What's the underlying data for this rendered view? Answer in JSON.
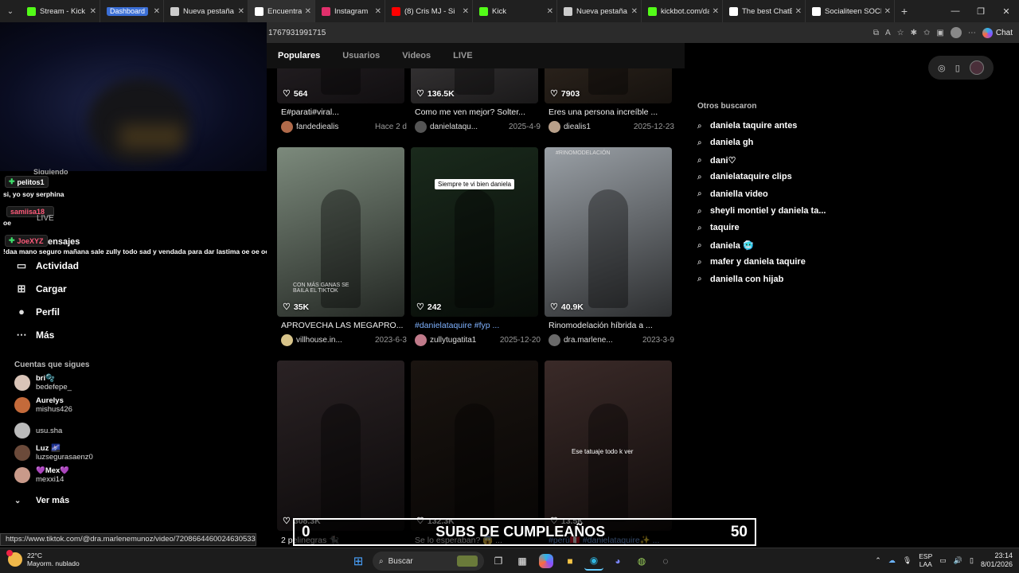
{
  "tabs": [
    {
      "label": "Stream - Kick Dash",
      "icon": "kick-icon",
      "color": "#53fc18"
    },
    {
      "label": "Dashboard",
      "icon": "badge-icon",
      "color": "#3b6fd6"
    },
    {
      "label": "Nueva pestaña",
      "icon": "page-icon",
      "color": "#cccccc"
    },
    {
      "label": "Encuentra 'Daniela",
      "icon": "tiktok-icon",
      "color": "#ffffff",
      "active": true
    },
    {
      "label": "Instagram",
      "icon": "instagram-icon",
      "color": "#e1306c"
    },
    {
      "label": "(8) Cris MJ - Si",
      "icon": "youtube-icon",
      "color": "#ff0000"
    },
    {
      "label": "Kick",
      "icon": "kick-icon",
      "color": "#53fc18"
    },
    {
      "label": "Nueva pestaña",
      "icon": "page-icon",
      "color": "#cccccc"
    },
    {
      "label": "kickbot.com/dashb",
      "icon": "kickbot-icon",
      "color": "#53fc18"
    },
    {
      "label": "The best ChatBot a",
      "icon": "chatbot-icon",
      "color": "#ffffff"
    },
    {
      "label": "Socialiteen SOCIAL",
      "icon": "page-icon",
      "color": "#ffffff"
    }
  ],
  "address": {
    "url": "1767931991715",
    "copilot_label": "Chat"
  },
  "chat": {
    "badge1": "pelitos1",
    "msg1": "si, yo soy serphina",
    "user2": "samiisa18",
    "msg2": "oe",
    "live_label": "LIVE",
    "badge3": "JoeXYZ",
    "messages_label": "ensajes",
    "partial_label": "Siguiendo",
    "msg3": "!daa mano seguro mañana sale zully todo sad y vendada para dar lastima oe oe oe"
  },
  "sidebar": {
    "nav": [
      {
        "label": "Actividad",
        "icon": "activity-icon",
        "glyph": "▭"
      },
      {
        "label": "Cargar",
        "icon": "upload-icon",
        "glyph": "⊞"
      },
      {
        "label": "Perfil",
        "icon": "profile-icon",
        "glyph": "●"
      },
      {
        "label": "Más",
        "icon": "more-icon",
        "glyph": "⋯"
      }
    ],
    "following_title": "Cuentas que sigues",
    "following": [
      {
        "name": "bri🫧",
        "user": "bedefepe_",
        "color": "#d9c4b8"
      },
      {
        "name": "Aurelys",
        "user": "mishus426",
        "color": "#c46a3a"
      },
      {
        "name": "",
        "user": "usu.sha",
        "color": "#bbbbbb"
      },
      {
        "name": "Luz 🌌",
        "user": "luzsegurasaenz0",
        "color": "#6b4a3a"
      },
      {
        "name": "💜Mex💜",
        "user": "mexxi14",
        "color": "#c99a8a"
      }
    ],
    "see_more": "Ver más"
  },
  "subtabs": [
    {
      "label": "Populares",
      "active": true
    },
    {
      "label": "Usuarios"
    },
    {
      "label": "Videos"
    },
    {
      "label": "LIVE"
    }
  ],
  "videos": [
    {
      "likes": "564",
      "title": "E#parati#viral...",
      "author": "fandediealis",
      "date": "Hace 2 d",
      "bg": "#3a3238",
      "av": "#b06a4a"
    },
    {
      "likes": "136.5K",
      "title": "Como me ven mejor? Solter...",
      "author": "danielataqu...",
      "date": "2025-4-9",
      "bg": "#5a5658",
      "av": "#555555"
    },
    {
      "likes": "7903",
      "title": "Eres una persona increíble ...",
      "author": "diealis1",
      "date": "2025-12-23",
      "bg": "#4a3c30",
      "av": "#b8a08a"
    },
    {
      "likes": "35K",
      "title": "APROVECHA LAS MEGAPRO...",
      "author": "villhouse.in...",
      "date": "2023-6-3",
      "bg": "#7c8a7c",
      "av": "#d8c48a",
      "watermark": "CON MÁS GANAS SE BAILA EL TIKTOK"
    },
    {
      "likes": "242",
      "title": "#danielataquire #fyp ...",
      "author": "zullytugatita1",
      "date": "2025-12-20",
      "bg": "#1a2a1c",
      "av": "#c07a8a",
      "caption": "Siempre te vi bien daniela",
      "hashtag": true
    },
    {
      "likes": "40.9K",
      "title": "Rinomodelación híbrida a ...",
      "author": "dra.marlene...",
      "date": "2023-3-9",
      "bg": "#9aa0a6",
      "av": "#6a6a6a",
      "watermark": "#RINOMODELACIÓN"
    },
    {
      "likes": "308.3K",
      "title": "2 pelinegras 🐈‍⬛",
      "author": "",
      "date": "",
      "bg": "#2a2224",
      "av": "#333333"
    },
    {
      "likes": "132.3K",
      "title": "Se lo esperaban? 😱 ...",
      "author": "",
      "date": "",
      "bg": "#1a1410",
      "av": "#333333"
    },
    {
      "likes": "13.5K",
      "title": "#perú🇵🇪 #danielataquire✨ ...",
      "author": "",
      "date": "",
      "bg": "#3a2a28",
      "av": "#333333",
      "caption": "Ese tatuaje todo k ver",
      "hashtag": true
    }
  ],
  "related": {
    "title": "Otros buscaron",
    "items": [
      "daniela taquire antes",
      "daniela gh",
      "dani♡",
      "danielataquire clips",
      "daniella video",
      "sheyli montiel y daniela ta...",
      "taquire",
      "daniela 🥶",
      "mafer y daniela taquire",
      "daniella con hijab"
    ]
  },
  "status_link": "https://www.tiktok.com/@dra.marlenemunoz/video/7208664460024630533",
  "subs_banner": {
    "left": "0",
    "title": "SUBS DE CUMPLEAÑOS",
    "right": "50"
  },
  "taskbar": {
    "temp": "22°C",
    "weather": "Mayorm. nublado",
    "search": "Buscar",
    "lang1": "ESP",
    "lang2": "LAA",
    "time": "23:14",
    "date": "8/01/2026"
  }
}
